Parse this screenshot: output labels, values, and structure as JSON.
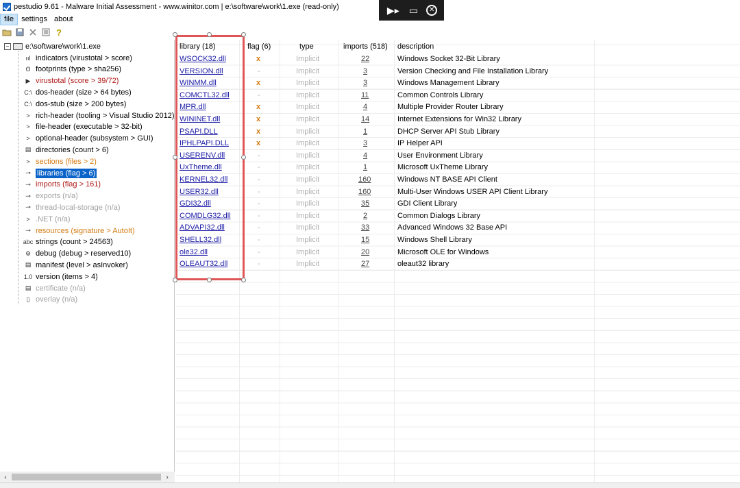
{
  "window": {
    "title": "pestudio 9.61 - Malware Initial Assessment - www.winitor.com | e:\\software\\work\\1.exe (read-only)"
  },
  "overlay": {
    "icon1": "▶▸",
    "icon2": "▭",
    "icon3": "✕"
  },
  "menu": {
    "file": "file",
    "settings": "settings",
    "about": "about"
  },
  "tree": {
    "root": "e:\\software\\work\\1.exe",
    "items": [
      {
        "label": "indicators (virustotal > score)",
        "style": "normal",
        "icon": "ııl"
      },
      {
        "label": "footprints (type > sha256)",
        "style": "normal",
        "icon": "ʘ"
      },
      {
        "label": "virustotal (score > 39/72)",
        "style": "red",
        "icon": "▶"
      },
      {
        "label": "dos-header (size > 64 bytes)",
        "style": "normal",
        "icon": "C:\\"
      },
      {
        "label": "dos-stub (size > 200 bytes)",
        "style": "normal",
        "icon": "C:\\"
      },
      {
        "label": "rich-header (tooling > Visual Studio 2012)",
        "style": "normal",
        "icon": ">"
      },
      {
        "label": "file-header (executable > 32-bit)",
        "style": "normal",
        "icon": ">"
      },
      {
        "label": "optional-header (subsystem > GUI)",
        "style": "normal",
        "icon": ">"
      },
      {
        "label": "directories (count > 6)",
        "style": "normal",
        "icon": "▤"
      },
      {
        "label": "sections (files > 2)",
        "style": "orange",
        "icon": ">"
      },
      {
        "label": "libraries (flag > 6)",
        "style": "selected",
        "icon": "⊸"
      },
      {
        "label": "imports (flag > 161)",
        "style": "red",
        "icon": "⊸"
      },
      {
        "label": "exports (n/a)",
        "style": "gray",
        "icon": "⊸"
      },
      {
        "label": "thread-local-storage (n/a)",
        "style": "gray",
        "icon": "⊸"
      },
      {
        "label": ".NET (n/a)",
        "style": "gray",
        "icon": ">"
      },
      {
        "label": "resources (signature > AutoIt)",
        "style": "orange",
        "icon": "⊸"
      },
      {
        "label": "strings (count > 24563)",
        "style": "normal",
        "icon": "abc"
      },
      {
        "label": "debug (debug > reserved10)",
        "style": "normal",
        "icon": "⚙"
      },
      {
        "label": "manifest (level > asInvoker)",
        "style": "normal",
        "icon": "▤"
      },
      {
        "label": "version (items > 4)",
        "style": "normal",
        "icon": "1.0"
      },
      {
        "label": "certificate (n/a)",
        "style": "gray",
        "icon": "▤"
      },
      {
        "label": "overlay (n/a)",
        "style": "gray",
        "icon": "▯"
      }
    ]
  },
  "grid": {
    "headers": {
      "library": "library (18)",
      "flag": "flag (6)",
      "type": "type",
      "imports": "imports (518)",
      "description": "description"
    },
    "rows": [
      {
        "library": "WSOCK32.dll",
        "flag": "x",
        "type": "Implicit",
        "imports": "22",
        "description": "Windows Socket 32-Bit Library"
      },
      {
        "library": "VERSION.dll",
        "flag": "-",
        "type": "Implicit",
        "imports": "3",
        "description": "Version Checking and File Installation Library"
      },
      {
        "library": "WINMM.dll",
        "flag": "x",
        "type": "Implicit",
        "imports": "3",
        "description": "Windows Management Library"
      },
      {
        "library": "COMCTL32.dll",
        "flag": "-",
        "type": "Implicit",
        "imports": "11",
        "description": "Common Controls Library"
      },
      {
        "library": "MPR.dll",
        "flag": "x",
        "type": "Implicit",
        "imports": "4",
        "description": "Multiple Provider Router Library"
      },
      {
        "library": "WININET.dll",
        "flag": "x",
        "type": "Implicit",
        "imports": "14",
        "description": "Internet Extensions for Win32 Library"
      },
      {
        "library": "PSAPI.DLL",
        "flag": "x",
        "type": "Implicit",
        "imports": "1",
        "description": "DHCP Server API Stub Library"
      },
      {
        "library": "IPHLPAPI.DLL",
        "flag": "x",
        "type": "Implicit",
        "imports": "3",
        "description": "IP Helper API"
      },
      {
        "library": "USERENV.dll",
        "flag": "-",
        "type": "Implicit",
        "imports": "4",
        "description": "User Environment Library"
      },
      {
        "library": "UxTheme.dll",
        "flag": "-",
        "type": "Implicit",
        "imports": "1",
        "description": "Microsoft UxTheme Library"
      },
      {
        "library": "KERNEL32.dll",
        "flag": "-",
        "type": "Implicit",
        "imports": "160",
        "description": "Windows NT BASE API Client"
      },
      {
        "library": "USER32.dll",
        "flag": "-",
        "type": "Implicit",
        "imports": "160",
        "description": "Multi-User Windows USER API Client Library"
      },
      {
        "library": "GDI32.dll",
        "flag": "-",
        "type": "Implicit",
        "imports": "35",
        "description": "GDI Client Library"
      },
      {
        "library": "COMDLG32.dll",
        "flag": "-",
        "type": "Implicit",
        "imports": "2",
        "description": "Common Dialogs Library"
      },
      {
        "library": "ADVAPI32.dll",
        "flag": "-",
        "type": "Implicit",
        "imports": "33",
        "description": "Advanced Windows 32 Base API"
      },
      {
        "library": "SHELL32.dll",
        "flag": "-",
        "type": "Implicit",
        "imports": "15",
        "description": "Windows Shell Library"
      },
      {
        "library": "ole32.dll",
        "flag": "-",
        "type": "Implicit",
        "imports": "20",
        "description": "Microsoft OLE for Windows"
      },
      {
        "library": "OLEAUT32.dll",
        "flag": "-",
        "type": "Implicit",
        "imports": "27",
        "description": "oleaut32 library"
      }
    ]
  },
  "colors": {
    "selection": "#0a63c9",
    "highlight": "#e05656",
    "flag": "#d47a10",
    "link": "#1a1aa6",
    "red_item": "#b01818",
    "orange_item": "#d47a10"
  }
}
